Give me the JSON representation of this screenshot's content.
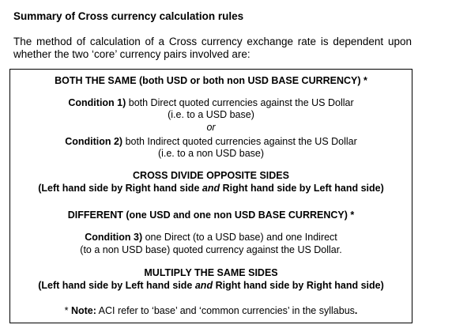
{
  "heading": "Summary of Cross currency calculation rules",
  "intro": "The method of calculation of a Cross currency exchange rate is dependent upon whether the two ‘core’ currency pairs involved are:",
  "box": {
    "same_title": "BOTH THE SAME (both USD or both non USD BASE CURRENCY) *",
    "cond1_label": "Condition 1)",
    "cond1_text": " both Direct quoted currencies against the US Dollar",
    "cond1_sub": "(i.e. to a USD base)",
    "or": "or",
    "cond2_label": "Condition 2)",
    "cond2_text": " both Indirect quoted currencies against the US Dollar",
    "cond2_sub": "(i.e. to a non USD base)",
    "rule1_title": "CROSS DIVIDE OPPOSITE SIDES",
    "rule1_part1": "(Left hand side by Right hand side ",
    "rule1_and": "and",
    "rule1_part2": " Right hand side by Left hand side)",
    "diff_title": "DIFFERENT (one USD and one non USD BASE CURRENCY) *",
    "cond3_label": "Condition 3)",
    "cond3_text": " one Direct (to a USD base) and one Indirect",
    "cond3_sub": "(to a non USD base) quoted currency against the US Dollar.",
    "rule2_title": "MULTIPLY THE SAME SIDES",
    "rule2_part1": "(Left hand side by Left hand side ",
    "rule2_and": "and",
    "rule2_part2": " Right hand side by Right hand side)",
    "note_star": "* ",
    "note_label": "Note:",
    "note_text": " ACI refer to ‘base’ and ‘common currencies’ in the syllabus",
    "note_end": "."
  }
}
